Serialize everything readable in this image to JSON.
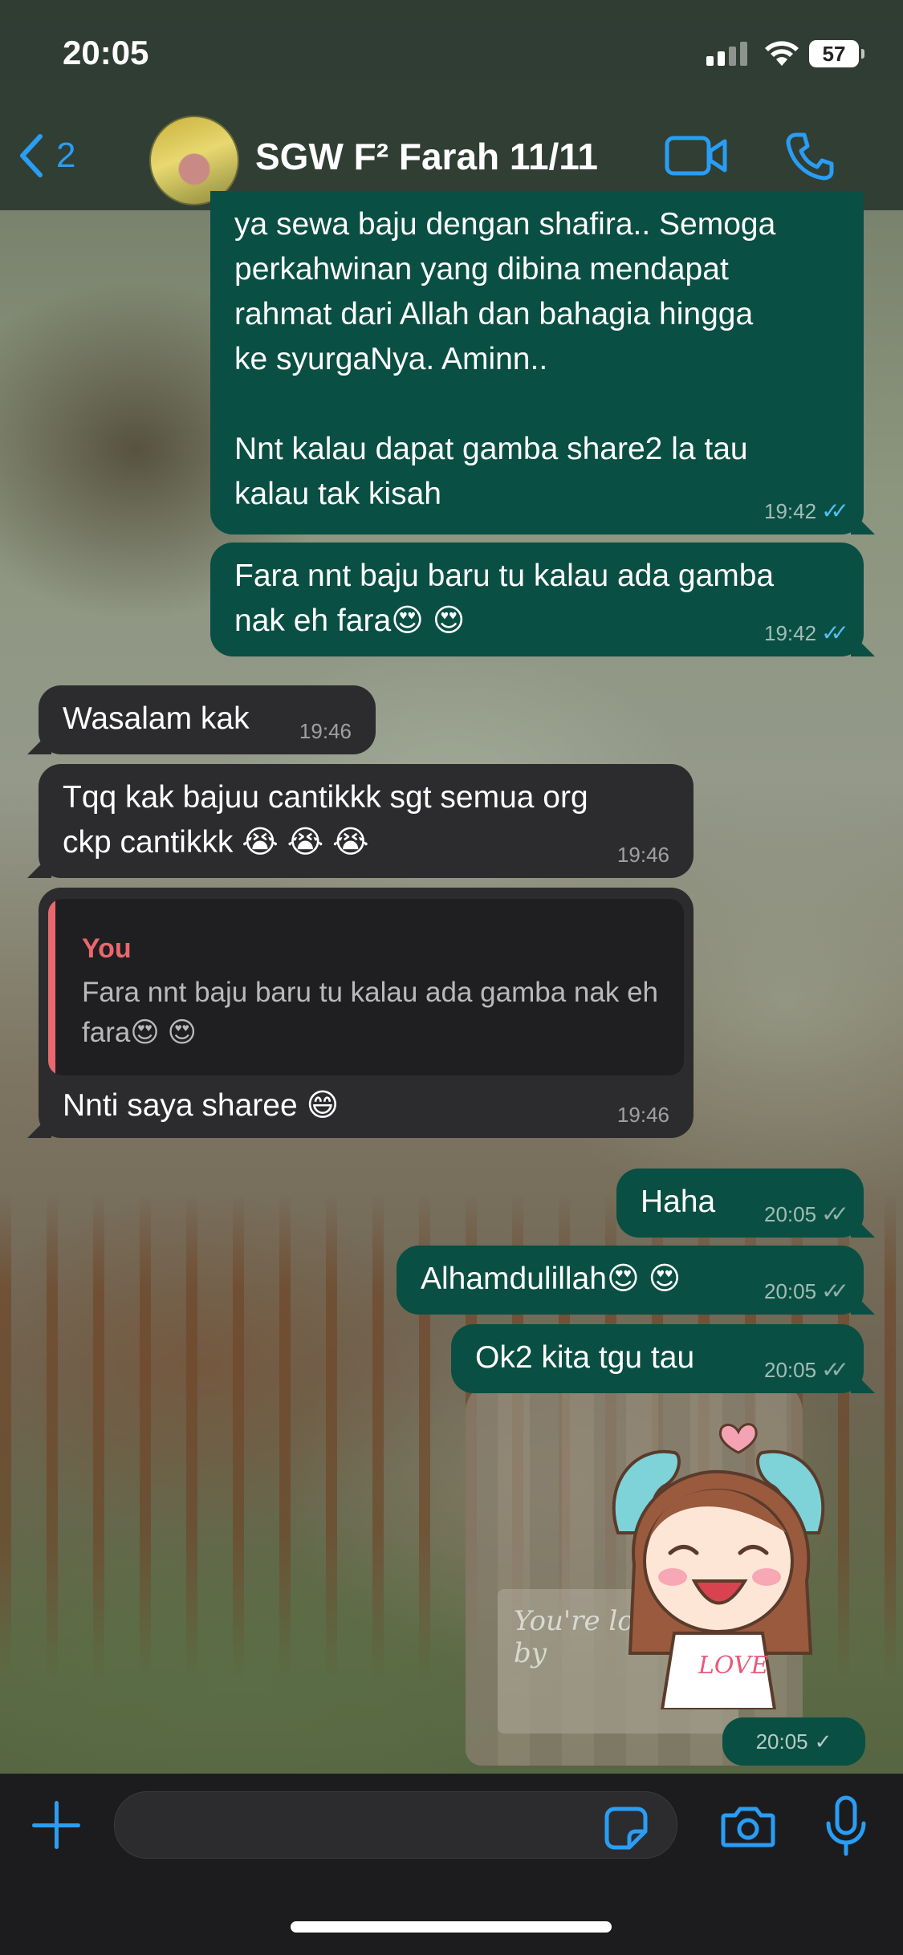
{
  "status_bar": {
    "time": "20:05",
    "battery": "57"
  },
  "header": {
    "back_count": "2",
    "title": "SGW F² Farah 11/11"
  },
  "messages": [
    {
      "text": "ya sewa baju dengan shafira.. Semoga\nperkahwinan yang dibina mendapat\nrahmat dari Allah dan bahagia hingga\nke syurgaNya. Aminn..\n\nNnt kalau dapat gamba share2 la tau\nkalau tak kisah",
      "time": "19:42",
      "status": "read"
    },
    {
      "text": "Fara nnt baju baru tu kalau ada gamba\nnak eh fara😍 😍",
      "time": "19:42",
      "status": "read"
    },
    {
      "text": "Wasalam kak",
      "time": "19:46"
    },
    {
      "text": "Tqq kak bajuu cantikkk sgt semua org\nckp cantikkk 😭 😭 😭",
      "time": "19:46"
    },
    {
      "quote_author": "You",
      "quote_text": "Fara nnt baju baru tu kalau ada gamba nak eh fara😍 😍",
      "text": "Nnti saya sharee 😄",
      "time": "19:46"
    },
    {
      "text": "Haha",
      "time": "20:05",
      "status": "delivered"
    },
    {
      "text": "Alhamdulillah😍 😍",
      "time": "20:05",
      "status": "delivered"
    },
    {
      "text": "Ok2 kita tgu tau",
      "time": "20:05",
      "status": "delivered"
    },
    {
      "sticker": "girl-heart-sticker",
      "sticker_text": "LOVE",
      "time": "20:05",
      "status": "sent"
    }
  ],
  "wallpaper": {
    "sign_text": "You're loved by"
  },
  "icons": {
    "read_ticks": "✓✓",
    "single_tick": "✓"
  },
  "colors": {
    "accent": "#2a9df4",
    "outgoing_bubble": "#0a4f43",
    "incoming_bubble": "#2c2c2e",
    "read_tick": "#53bdeb",
    "quote_bar": "#e9686e"
  }
}
